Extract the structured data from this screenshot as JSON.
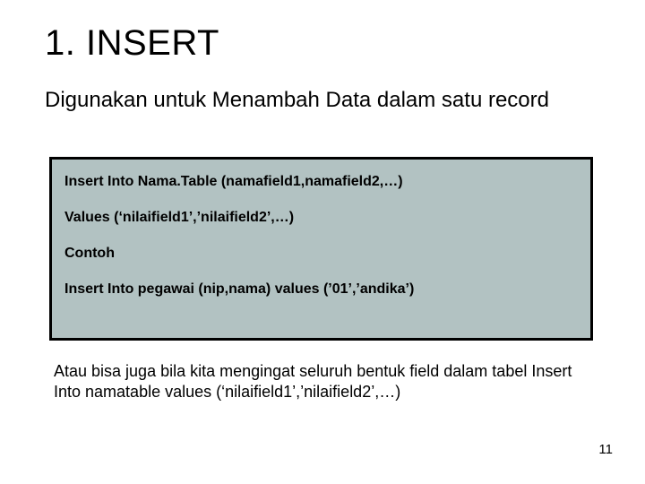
{
  "heading": "1.  INSERT",
  "subtitle": "Digunakan untuk Menambah Data dalam satu record",
  "codebox": {
    "line1": "Insert Into Nama.Table (namafield1,namafield2,…)",
    "line2": "Values (‘nilaifield1’,’nilaifield2’,…)",
    "line3": "Contoh",
    "line4": "Insert Into pegawai (nip,nama) values (’01’,’andika’)"
  },
  "footnote": "Atau bisa juga bila kita mengingat seluruh bentuk field dalam tabel Insert Into namatable values (‘nilaifield1’,’nilaifield2’,…)",
  "pagenum": "11"
}
